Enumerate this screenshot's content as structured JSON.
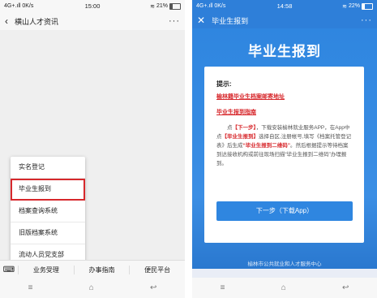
{
  "left_phone": {
    "status": {
      "left": "4G+.ıll 0K/s",
      "time": "15:00",
      "battery": "21%",
      "battery_level": 0.21
    },
    "title": "横山人才资讯",
    "popup_menu": [
      "实名登记",
      "毕业生报到",
      "档案查询系统",
      "旧版档案系统",
      "流动人员党支部"
    ],
    "highlighted_index": 1,
    "bottom_menu": [
      "业务受理",
      "办事指南",
      "便民平台"
    ],
    "nav": [
      "≡",
      "⌂",
      "↩"
    ]
  },
  "right_phone": {
    "status": {
      "left": "4G+.ıll 0K/s",
      "time": "14:58",
      "battery": "22%",
      "battery_level": 0.22
    },
    "title": "毕业生报到",
    "banner_title": "毕业生报到",
    "tip_label": "提示:",
    "link1": "榆林籍毕业生档案邮寄地址",
    "link2": "毕业生报到指南",
    "body_parts": [
      "点",
      "【下一步】",
      "，下载安装榆林就业服务APP，在App中点",
      "【毕业生报到】",
      "选择自区,注册帐号,填写《档案托管登记表》后生成",
      "“毕业生报到二维码”",
      "。然后根据提示等待档案到达接收机构或前往现场扫描“毕业生报到二维码”办理报到。"
    ],
    "next_button": "下一步（下载App）",
    "footer": "榆林市公共就业和人才服务中心",
    "nav": [
      "≡",
      "⌂",
      "↩"
    ]
  }
}
